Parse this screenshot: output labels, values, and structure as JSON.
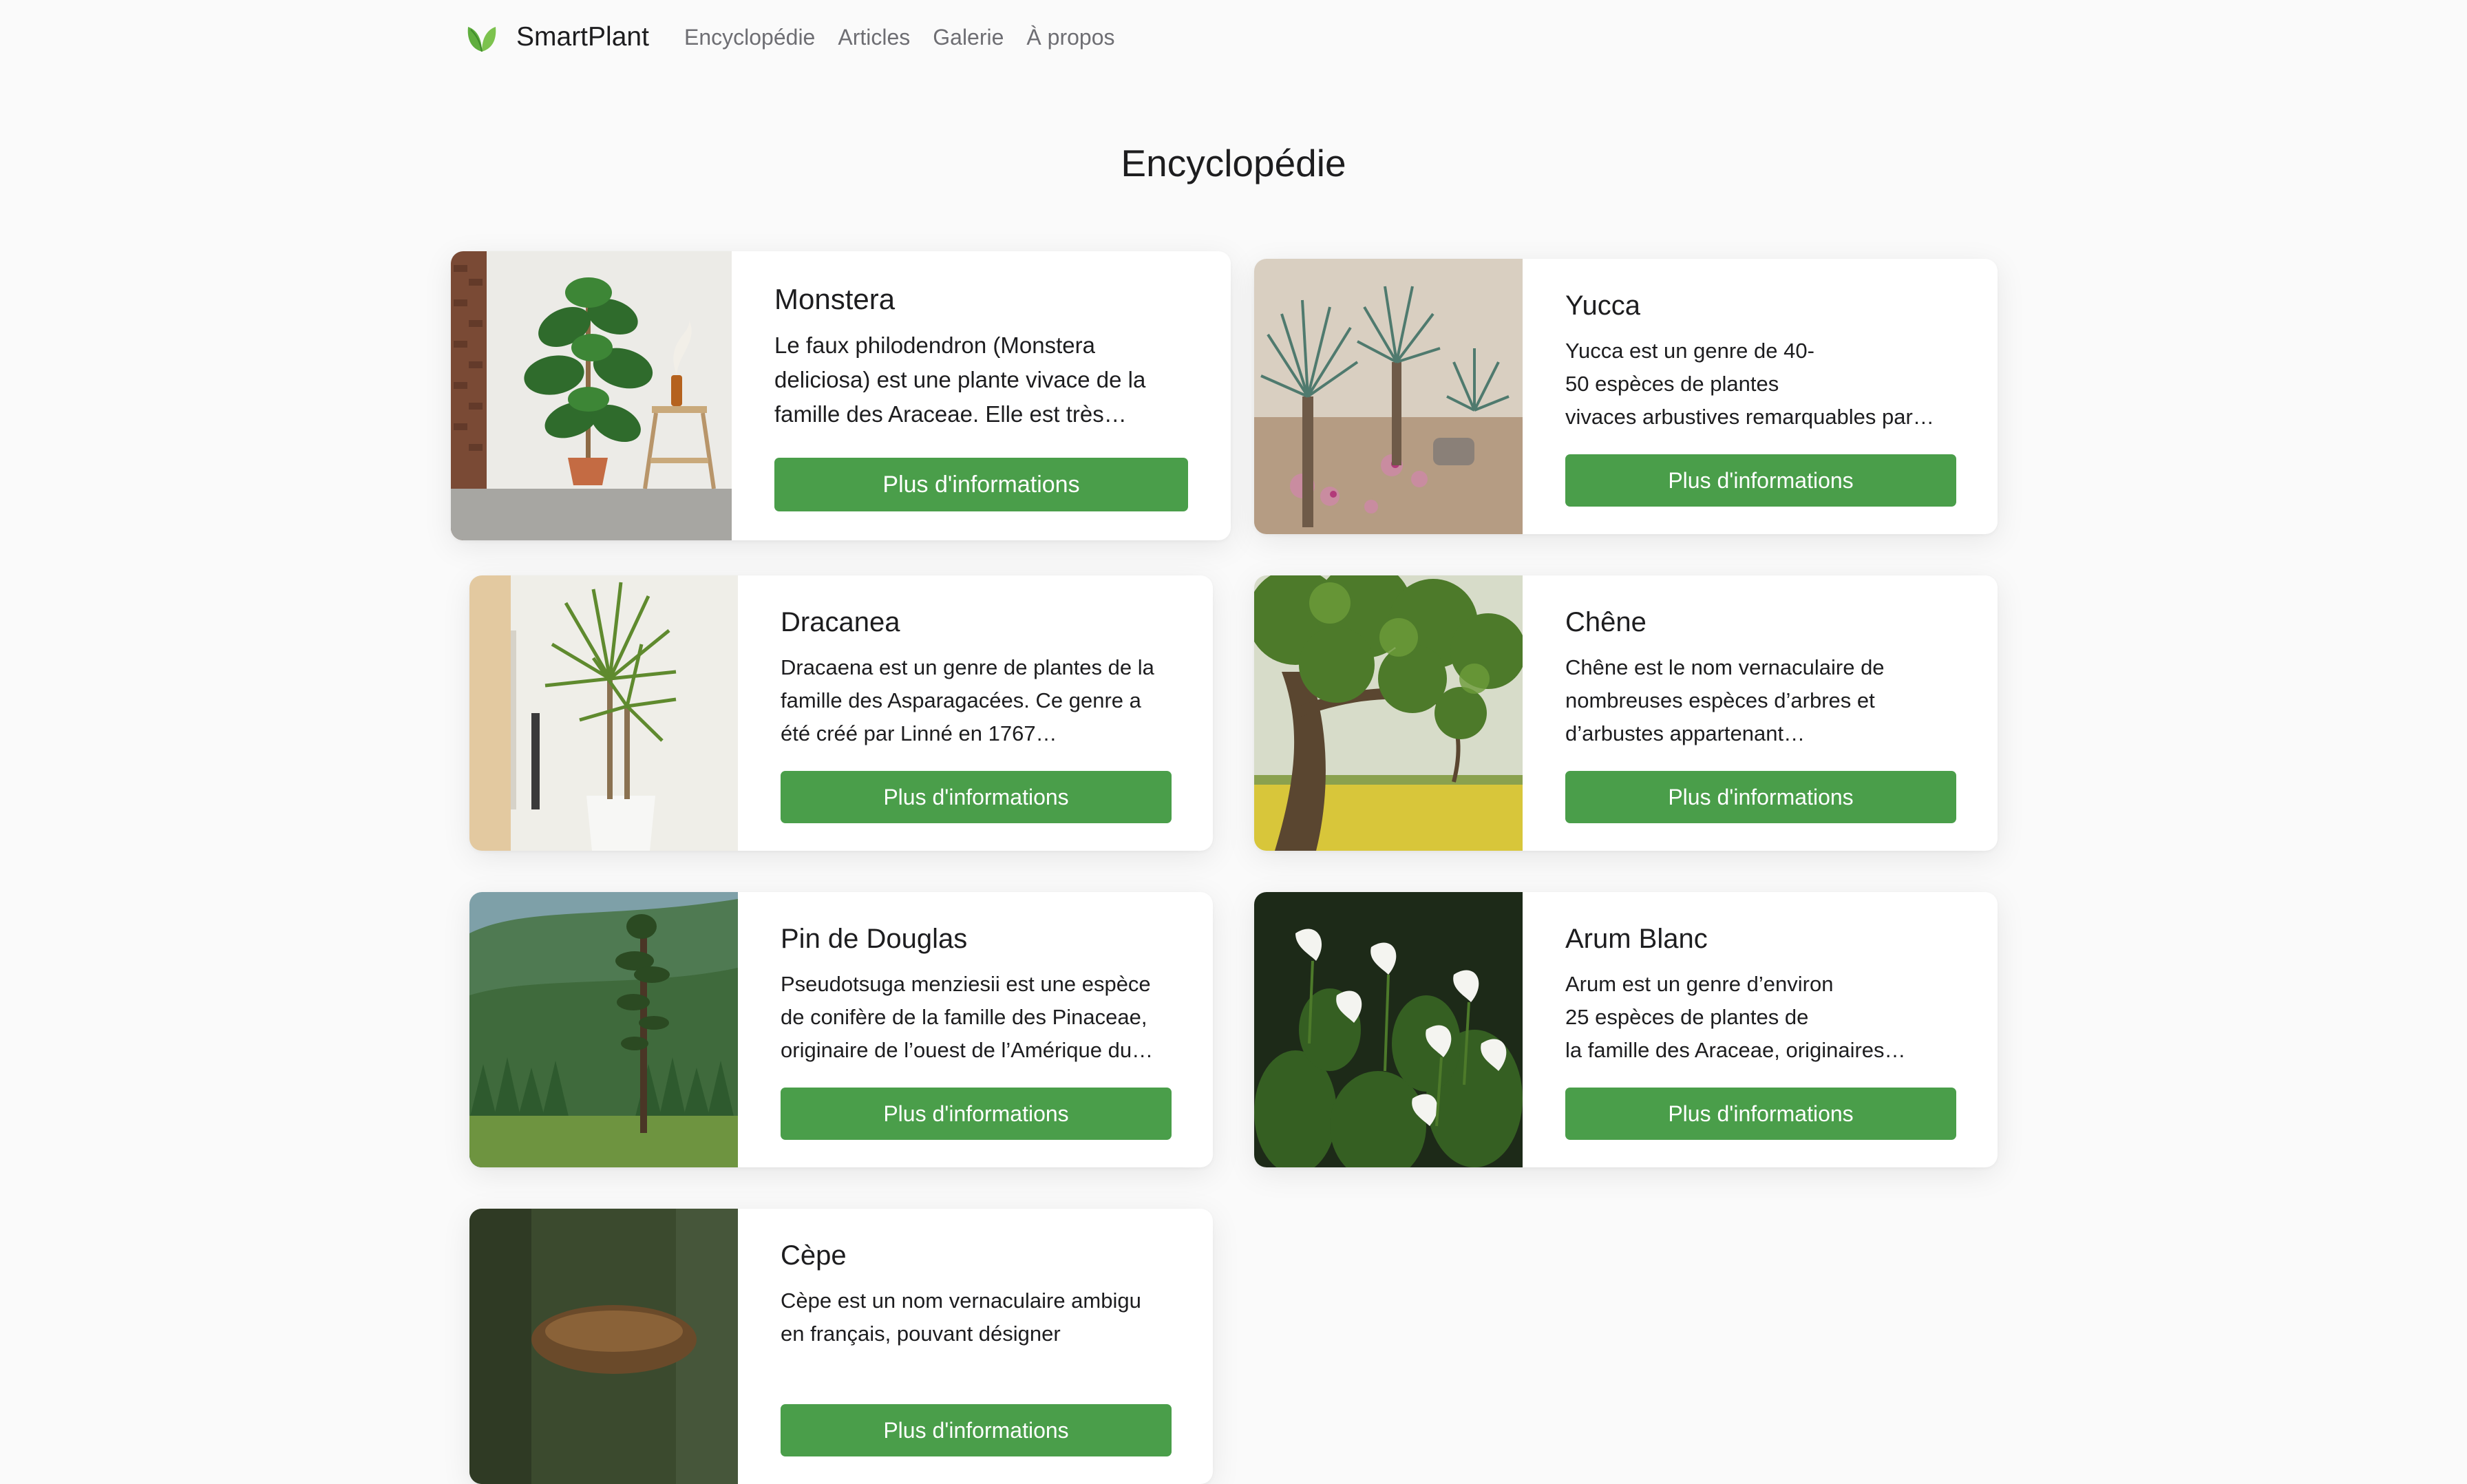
{
  "navbar": {
    "brand": "SmartPlant",
    "logo_icon": "leaf-icon",
    "links": [
      "Encyclopédie",
      "Articles",
      "Galerie",
      "À propos"
    ]
  },
  "page": {
    "title": "Encyclopédie"
  },
  "cards": [
    {
      "title": "Monstera",
      "lines": [
        "Le faux philodendron (Monstera",
        "deliciosa) est une plante vivace de la",
        "famille des Araceae. Elle est très…"
      ],
      "button": "Plus d'informations"
    },
    {
      "title": "Yucca",
      "lines": [
        "Yucca est un genre de 40-",
        "50 espèces de plantes",
        "vivaces arbustives remarquables par…"
      ],
      "button": "Plus d'informations"
    },
    {
      "title": "Dracanea",
      "lines": [
        "Dracaena est un genre de plantes de la",
        "famille des Asparagacées. Ce genre a",
        "été créé par Linné en 1767…"
      ],
      "button": "Plus d'informations"
    },
    {
      "title": "Chêne",
      "lines": [
        "Chêne est le nom vernaculaire de",
        "nombreuses espèces d’arbres et",
        "d’arbustes appartenant…"
      ],
      "button": "Plus d'informations"
    },
    {
      "title": "Pin de Douglas",
      "lines": [
        "Pseudotsuga menziesii est une espèce",
        "de conifère de la famille des Pinaceae,",
        "originaire de l’ouest de l’Amérique du…"
      ],
      "button": "Plus d'informations"
    },
    {
      "title": "Arum Blanc",
      "lines": [
        "Arum est un genre d’environ",
        "25 espèces de plantes de",
        "la famille des Araceae, originaires…"
      ],
      "button": "Plus d'informations"
    },
    {
      "title": "Cèpe",
      "lines": [
        "Cèpe est un nom vernaculaire ambigu",
        "en français, pouvant désigner"
      ],
      "button": "Plus d'informations"
    }
  ],
  "colors": {
    "accent": "#4a9e4a",
    "background": "#fafafa",
    "card": "#ffffff"
  }
}
